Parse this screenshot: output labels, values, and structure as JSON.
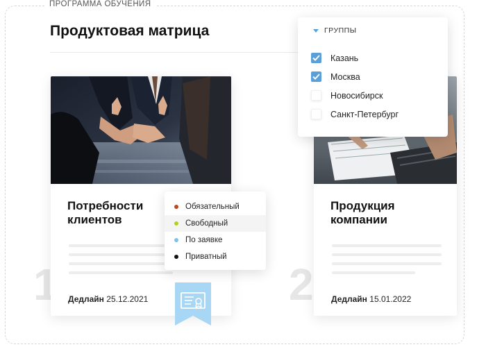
{
  "header": {
    "program_label": "ПРОГРАММА ОБУЧЕНИЯ",
    "title": "Продуктовая матрица"
  },
  "groups_dropdown": {
    "label": "ГРУППЫ",
    "options": [
      {
        "label": "Казань",
        "checked": true
      },
      {
        "label": "Москва",
        "checked": true
      },
      {
        "label": "Новосибирск",
        "checked": false
      },
      {
        "label": "Санкт-Петербург",
        "checked": false
      }
    ],
    "check_color": "#5b9fd9"
  },
  "type_dropdown": {
    "options": [
      {
        "label": "Обязательный",
        "color": "#c0461b",
        "highlighted": false
      },
      {
        "label": "Свободный",
        "color": "#b5cf1a",
        "highlighted": true
      },
      {
        "label": "По заявке",
        "color": "#7cc3ea",
        "highlighted": false
      },
      {
        "label": "Приватный",
        "color": "#111111",
        "highlighted": false
      }
    ]
  },
  "courses": [
    {
      "step": "1",
      "title": "Потребности клиентов",
      "deadline_label": "Дедлайн",
      "deadline_date": "25.12.2021",
      "image": "handshake-photo"
    },
    {
      "step": "2",
      "title": "Продукция компании",
      "deadline_label": "Дедлайн",
      "deadline_date": "15.01.2022",
      "image": "laptop-notes-photo"
    }
  ],
  "certificate_badge": {
    "icon": "certificate-icon",
    "color": "#a8d6f5"
  }
}
